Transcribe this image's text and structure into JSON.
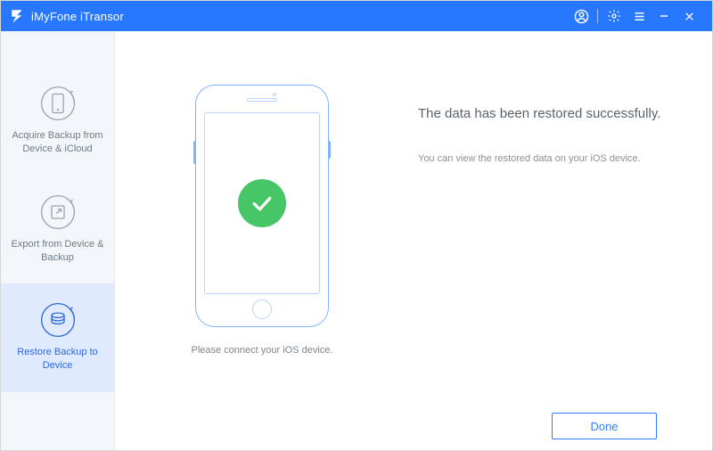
{
  "titlebar": {
    "app_name": "iMyFone iTransor"
  },
  "sidebar": {
    "items": [
      {
        "label": "Acquire Backup from Device & iCloud"
      },
      {
        "label": "Export from Device & Backup"
      },
      {
        "label": "Restore Backup to Device"
      }
    ]
  },
  "content": {
    "connect_prompt": "Please connect your iOS device.",
    "success_title": "The data has been restored successfully.",
    "success_subtitle": "You can view the restored data on your iOS device."
  },
  "footer": {
    "done_label": "Done"
  },
  "colors": {
    "primary": "#2878ff",
    "success": "#46c667"
  }
}
